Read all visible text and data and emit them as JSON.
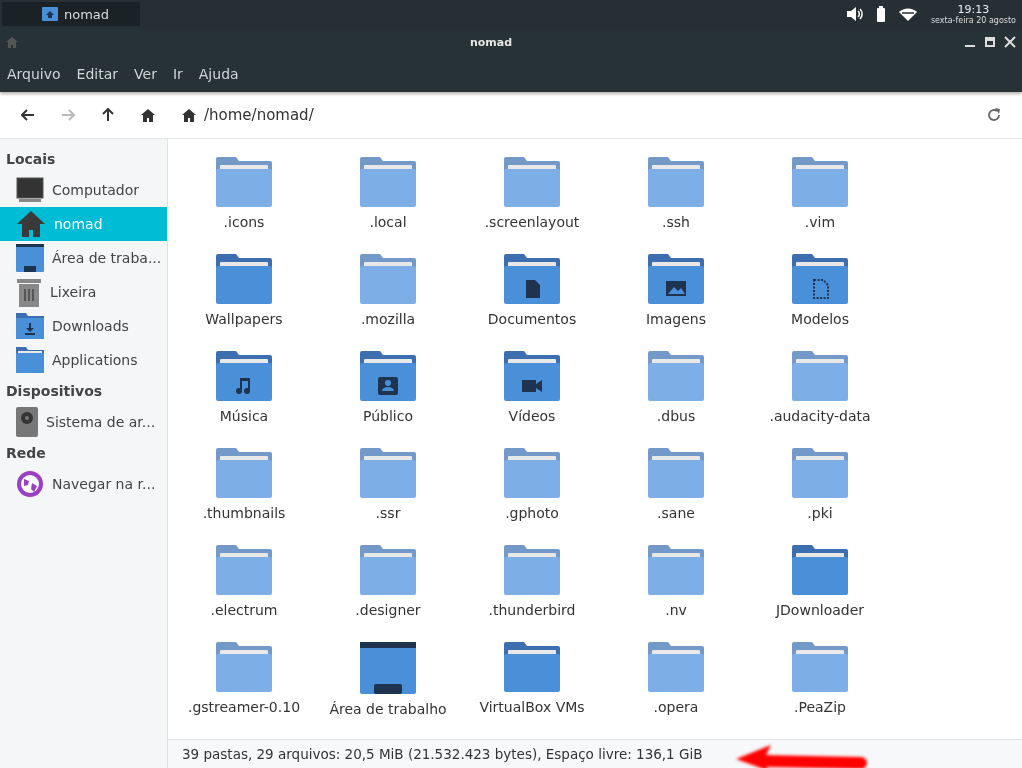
{
  "top_panel": {
    "task": "nomad",
    "time": "19:13",
    "date": "sexta-feira 20 agosto"
  },
  "window": {
    "title": "nomad"
  },
  "menu": [
    "Arquivo",
    "Editar",
    "Ver",
    "Ir",
    "Ajuda"
  ],
  "location": {
    "path": "/home/nomad/"
  },
  "sidebar": [
    {
      "heading": "Locais",
      "items": [
        {
          "label": "Computador",
          "kind": "computer",
          "selected": false
        },
        {
          "label": "nomad",
          "kind": "home",
          "selected": true
        },
        {
          "label": "Área de traba...",
          "kind": "desktop",
          "selected": false
        },
        {
          "label": "Lixeira",
          "kind": "trash",
          "selected": false
        },
        {
          "label": "Downloads",
          "kind": "downloads",
          "selected": false
        },
        {
          "label": "Applications",
          "kind": "folder",
          "selected": false
        }
      ]
    },
    {
      "heading": "Dispositivos",
      "items": [
        {
          "label": "Sistema de ar...",
          "kind": "drive",
          "selected": false
        }
      ]
    },
    {
      "heading": "Rede",
      "items": [
        {
          "label": "Navegar na r...",
          "kind": "network",
          "selected": false
        }
      ]
    }
  ],
  "folders": [
    {
      "name": ".icons",
      "kind": "hidden"
    },
    {
      "name": ".local",
      "kind": "hidden"
    },
    {
      "name": ".screenlayout",
      "kind": "hidden"
    },
    {
      "name": ".ssh",
      "kind": "hidden"
    },
    {
      "name": ".vim",
      "kind": "hidden"
    },
    {
      "name": "Wallpapers",
      "kind": "plain"
    },
    {
      "name": ".mozilla",
      "kind": "hidden"
    },
    {
      "name": "Documentos",
      "kind": "documents"
    },
    {
      "name": "Imagens",
      "kind": "pictures"
    },
    {
      "name": "Modelos",
      "kind": "templates"
    },
    {
      "name": "Música",
      "kind": "music"
    },
    {
      "name": "Público",
      "kind": "public"
    },
    {
      "name": "Vídeos",
      "kind": "videos"
    },
    {
      "name": ".dbus",
      "kind": "hidden"
    },
    {
      "name": ".audacity-data",
      "kind": "hidden"
    },
    {
      "name": ".thumbnails",
      "kind": "hidden"
    },
    {
      "name": ".ssr",
      "kind": "hidden"
    },
    {
      "name": ".gphoto",
      "kind": "hidden"
    },
    {
      "name": ".sane",
      "kind": "hidden"
    },
    {
      "name": ".pki",
      "kind": "hidden"
    },
    {
      "name": ".electrum",
      "kind": "hidden"
    },
    {
      "name": ".designer",
      "kind": "hidden"
    },
    {
      "name": ".thunderbird",
      "kind": "hidden"
    },
    {
      "name": ".nv",
      "kind": "hidden"
    },
    {
      "name": "JDownloader",
      "kind": "plain"
    },
    {
      "name": ".gstreamer-0.10",
      "kind": "hidden"
    },
    {
      "name": "Área de trabalho",
      "kind": "desktop"
    },
    {
      "name": "VirtualBox VMs",
      "kind": "plain"
    },
    {
      "name": ".opera",
      "kind": "hidden"
    },
    {
      "name": ".PeaZip",
      "kind": "hidden"
    }
  ],
  "status_bar": {
    "text": "39 pastas, 29 arquivos: 20,5 MiB (21.532.423 bytes), Espaço livre: 136,1 GiB"
  }
}
